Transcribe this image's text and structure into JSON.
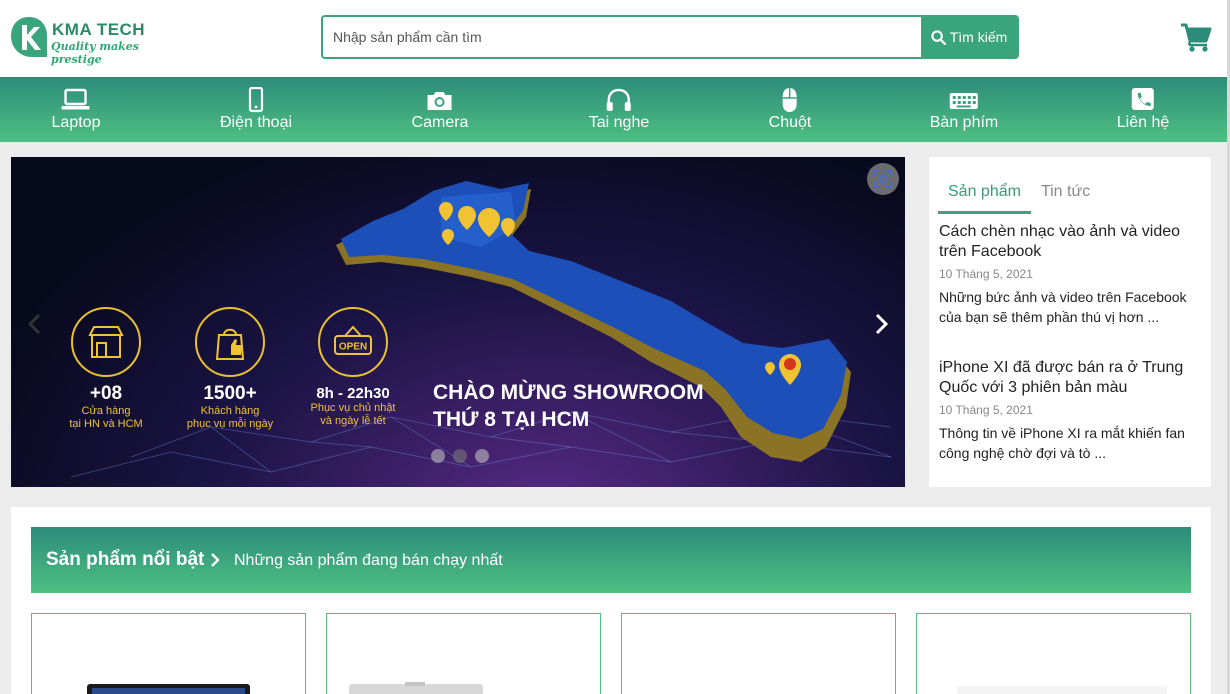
{
  "header": {
    "logo": {
      "name": "KMA TECH",
      "tagline": "Quality makes prestige",
      "icon": "k-logo-icon"
    },
    "search": {
      "placeholder": "Nhập sản phẩm cần tìm",
      "value": "",
      "button_label": "Tìm kiếm",
      "icon": "search-icon"
    },
    "cart": {
      "icon": "cart-icon"
    }
  },
  "nav": {
    "items": [
      {
        "label": "Laptop",
        "icon": "laptop-icon"
      },
      {
        "label": "Điện thoại",
        "icon": "phone-icon"
      },
      {
        "label": "Camera",
        "icon": "camera-icon"
      },
      {
        "label": "Tai nghe",
        "icon": "headphones-icon"
      },
      {
        "label": "Chuột",
        "icon": "mouse-icon"
      },
      {
        "label": "Bàn phím",
        "icon": "keyboard-icon"
      },
      {
        "label": "Liên hệ",
        "icon": "phone-call-icon"
      }
    ]
  },
  "banner": {
    "stats": [
      {
        "value": "+08",
        "line1": "Cửa hàng",
        "line2": "tại HN và HCM",
        "icon": "store-icon"
      },
      {
        "value": "1500+",
        "line1": "Khách hàng",
        "line2": "phục vụ mỗi ngày",
        "icon": "thumbs-up-icon"
      },
      {
        "value": "8h - 22h30",
        "line1": "Phục vụ chủ nhật",
        "line2": "và ngày lễ tết",
        "icon": "open-sign-icon",
        "sign_text": "OPEN"
      }
    ],
    "headline_line1": "CHÀO MỪNG SHOWROOM",
    "headline_line2": "THỨ 8 TẠI HCM",
    "slide_count": 3,
    "active_slide": 2
  },
  "side": {
    "tabs": [
      {
        "label": "Sản phẩm",
        "active": true
      },
      {
        "label": "Tin tức",
        "active": false
      }
    ],
    "news": [
      {
        "title": "Cách chèn nhạc vào ảnh và video trên Facebook",
        "date": "10 Tháng 5, 2021",
        "desc": "Những bức ảnh và video trên Facebook của bạn sẽ thêm phần thú vị hơn ..."
      },
      {
        "title": "iPhone XI đã được bán ra ở Trung Quốc với 3 phiên bản màu",
        "date": "10 Tháng 5, 2021",
        "desc": "Thông tin về iPhone XI ra mắt khiến fan công nghệ chờ đợi và tò ..."
      }
    ]
  },
  "featured": {
    "title": "Sản phẩm nổi bật",
    "subtitle": "Những sản phẩm đang bán chạy nhất",
    "cards": 4
  },
  "colors": {
    "primary": "#3aa57d",
    "gradient_top": "#2c8c7a",
    "gradient_bottom": "#4fbf82",
    "banner_gold": "#e9c032"
  }
}
